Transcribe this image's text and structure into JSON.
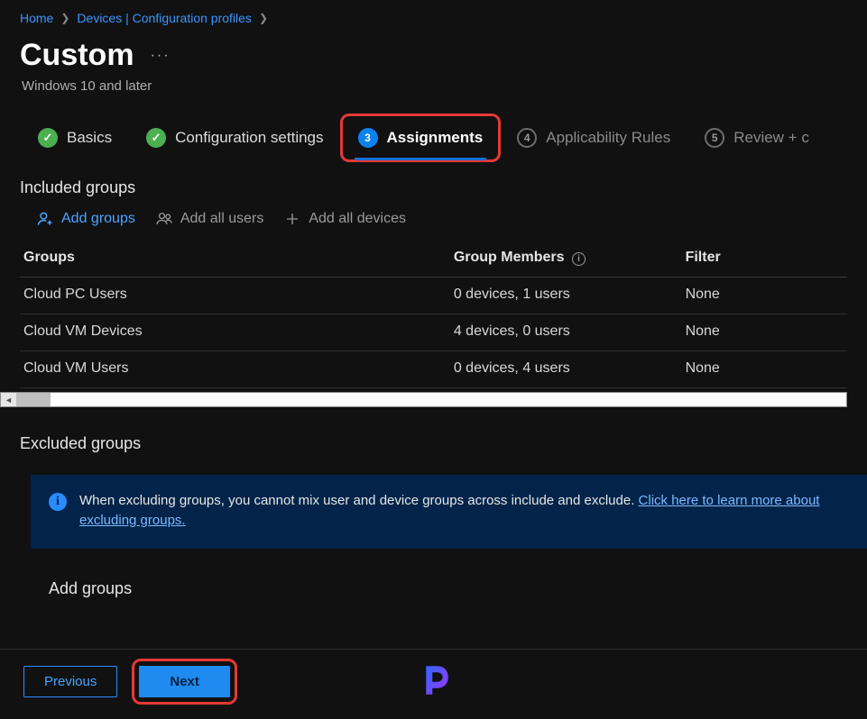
{
  "breadcrumb": {
    "home": "Home",
    "devices": "Devices | Configuration profiles"
  },
  "title": "Custom",
  "subtitle": "Windows 10 and later",
  "wizard": {
    "basics": "Basics",
    "config": "Configuration settings",
    "assignments": "Assignments",
    "assignments_num": "3",
    "applicability": "Applicability Rules",
    "applicability_num": "4",
    "review": "Review + c",
    "review_num": "5"
  },
  "sections": {
    "included": "Included groups",
    "excluded": "Excluded groups"
  },
  "actions": {
    "add_groups": "Add groups",
    "add_all_users": "Add all users",
    "add_all_devices": "Add all devices"
  },
  "table": {
    "col_groups": "Groups",
    "col_members": "Group Members",
    "col_filter": "Filter",
    "rows": [
      {
        "name": "Cloud PC Users",
        "members": "0 devices, 1 users",
        "filter": "None"
      },
      {
        "name": "Cloud VM Devices",
        "members": "4 devices, 0 users",
        "filter": "None"
      },
      {
        "name": "Cloud VM Users",
        "members": "0 devices, 4 users",
        "filter": "None"
      }
    ]
  },
  "banner": {
    "text": "When excluding groups, you cannot mix user and device groups across include and exclude. ",
    "link": "Click here to learn more about excluding groups."
  },
  "below_banner": "Add groups",
  "footer": {
    "previous": "Previous",
    "next": "Next"
  }
}
